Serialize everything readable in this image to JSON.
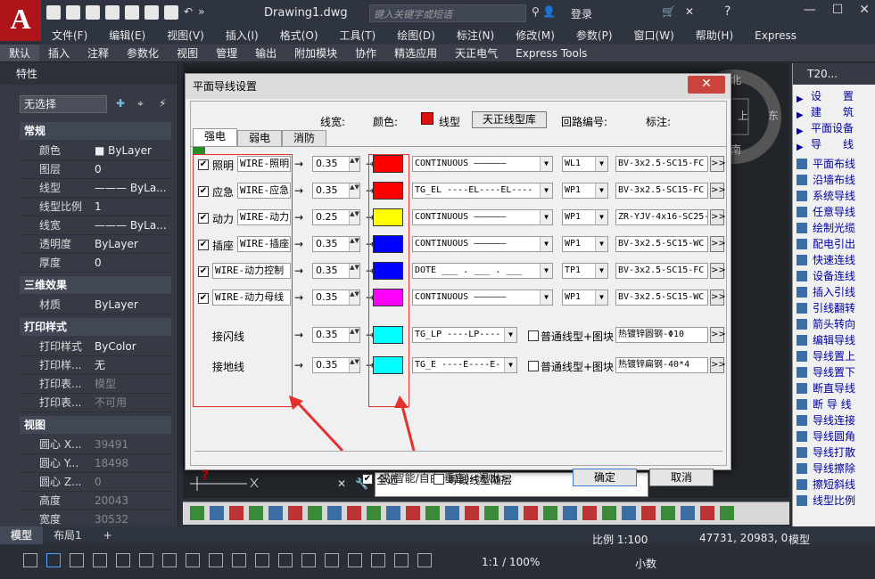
{
  "app": {
    "logo": "A",
    "title": "Drawing1.dwg",
    "search_placeholder": "键入关键字或短语",
    "login": "登录"
  },
  "menubar": [
    "文件(F)",
    "编辑(E)",
    "视图(V)",
    "插入(I)",
    "格式(O)",
    "工具(T)",
    "绘图(D)",
    "标注(N)",
    "修改(M)",
    "参数(P)",
    "窗口(W)",
    "帮助(H)",
    "Express"
  ],
  "ribbon_tabs": [
    "默认",
    "插入",
    "注释",
    "参数化",
    "视图",
    "管理",
    "输出",
    "附加模块",
    "协作",
    "精选应用",
    "天正电气",
    "Express Tools"
  ],
  "palette": {
    "title": "特性",
    "selection": "无选择",
    "sections": {
      "general": "常规",
      "three_d": "三维效果",
      "print": "打印样式",
      "view": "视图"
    },
    "general_rows": [
      {
        "k": "颜色",
        "v": "■ ByLayer"
      },
      {
        "k": "图层",
        "v": "0"
      },
      {
        "k": "线型",
        "v": "——— ByLa..."
      },
      {
        "k": "线型比例",
        "v": "1"
      },
      {
        "k": "线宽",
        "v": "——— ByLa..."
      },
      {
        "k": "透明度",
        "v": "ByLayer"
      },
      {
        "k": "厚度",
        "v": "0"
      }
    ],
    "three_d_rows": [
      {
        "k": "材质",
        "v": "ByLayer"
      }
    ],
    "print_rows": [
      {
        "k": "打印样式",
        "v": "ByColor"
      },
      {
        "k": "打印样...",
        "v": "无"
      },
      {
        "k": "打印表...",
        "v": "模型"
      },
      {
        "k": "打印表...",
        "v": "不可用"
      }
    ],
    "view_rows": [
      {
        "k": "圆心 X...",
        "v": "39491"
      },
      {
        "k": "圆心 Y...",
        "v": "18498"
      },
      {
        "k": "圆心 Z...",
        "v": "0"
      },
      {
        "k": "高度",
        "v": "20043"
      },
      {
        "k": "宽度",
        "v": "30532"
      }
    ]
  },
  "compass": {
    "north": "北",
    "east": "东",
    "south": "南",
    "center": "上"
  },
  "right_palette": {
    "title": "T20...",
    "top_items": [
      "设　　置",
      "建　　筑",
      "平面设备",
      "导　　线"
    ],
    "items": [
      "平面布线",
      "沿墙布线",
      "系统导线",
      "任意导线",
      "绘制光缆",
      "配电引出",
      "快速连线",
      "设备连线",
      "插入引线",
      "引线翻转",
      "箭头转向",
      "编辑导线",
      "导线置上",
      "导线置下",
      "断直导线",
      "断 导 线",
      "导线连接",
      "导线圆角",
      "导线打散",
      "导线擦除",
      "擦短斜线",
      "线型比例"
    ]
  },
  "layout_tabs": [
    "模型",
    "布局1",
    "+"
  ],
  "status": {
    "scale": "比例 1:100",
    "coords": "47731, 20983, 0",
    "model": "模型",
    "zoom": "1:1 / 100%",
    "units": "小数"
  },
  "command_line": "或(智能/自由/垂直)<退出>:",
  "dialog": {
    "title": "平面导线设置",
    "close": "✕",
    "headers": {
      "width": "线宽:",
      "color": "颜色:",
      "ltype": "线型",
      "lib": "天正线型库",
      "circuit": "回路编号:",
      "mark": "标注:"
    },
    "tabs": [
      "强电",
      "弱电",
      "消防"
    ],
    "rows": [
      {
        "checked": true,
        "label": "照明",
        "wire": "WIRE-照明",
        "width": "0.35",
        "color": "#ff0000",
        "ltype": "CONTINUOUS ——————",
        "circuit": "WL1",
        "mark": "BV-3x2.5-SC15-FC"
      },
      {
        "checked": true,
        "label": "应急",
        "wire": "WIRE-应急",
        "width": "0.35",
        "color": "#ff0000",
        "ltype": "TG_EL ----EL----EL----",
        "circuit": "WP1",
        "mark": "BV-3x2.5-SC15-FC"
      },
      {
        "checked": true,
        "label": "动力",
        "wire": "WIRE-动力",
        "width": "0.25",
        "color": "#ffff00",
        "ltype": "CONTINUOUS ——————",
        "circuit": "WP1",
        "mark": "ZR-YJV-4x16-SC25-"
      },
      {
        "checked": true,
        "label": "插座",
        "wire": "WIRE-插座",
        "width": "0.35",
        "color": "#0000ff",
        "ltype": "CONTINUOUS ——————",
        "circuit": "WP1",
        "mark": "BV-3x2.5-SC15-WC"
      },
      {
        "checked": true,
        "label": "",
        "wire": "WIRE-动力控制",
        "width": "0.35",
        "color": "#0000ff",
        "ltype": "DOTE ___ . ___ . ___",
        "circuit": "TP1",
        "mark": "BV-3x2.5-SC15-FC"
      },
      {
        "checked": true,
        "label": "",
        "wire": "WIRE-动力母线",
        "width": "0.35",
        "color": "#ff00ff",
        "ltype": "CONTINUOUS ——————",
        "circuit": "WP1",
        "mark": "BV-3x2.5-SC15-WC"
      }
    ],
    "extra_rows": [
      {
        "label": "接闪线",
        "width": "0.35",
        "color": "#00ffff",
        "ltype": "TG_LP ----LP----",
        "opt": "普通线型+图块",
        "mark": "热镀锌圆钢-Φ10"
      },
      {
        "label": "接地线",
        "width": "0.35",
        "color": "#00ffff",
        "ltype": "TG_E ----E----E-",
        "opt": "普通线型+图块",
        "mark": "热镀锌扁钢-40*4"
      }
    ],
    "more": ">>",
    "select_all": "全选",
    "follow_layer": "导线线型随层",
    "ok": "确定",
    "cancel": "取消",
    "help": "?"
  },
  "colors": {
    "annotation_red": "#e53030"
  }
}
